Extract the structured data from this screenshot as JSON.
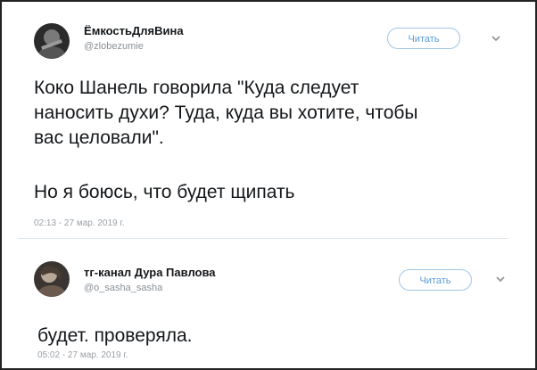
{
  "tweets": [
    {
      "name": "ЁмкостьДляВина",
      "handle": "@zlobezumie",
      "follow_label": "Читать",
      "body_paragraph_1": [
        "Коко Шанель говорила \"Куда следует",
        "наносить духи? Туда, куда вы хотите, чтобы",
        "вас целовали\"."
      ],
      "body_paragraph_2": "Но я боюсь, что будет щипать",
      "timestamp": "02:13 - 27 мар. 2019 г.",
      "avatar_icon": "avatar-photo-icon"
    },
    {
      "name": "тг-канал Дура Павлова",
      "handle": "@o_sasha_sasha",
      "follow_label": "Читать",
      "body": "будет. проверяла.",
      "timestamp": "05:02 - 27 мар. 2019 г.",
      "avatar_icon": "avatar-photo-icon"
    }
  ],
  "colors": {
    "accent": "#5a9bd5",
    "text": "#14171a",
    "muted": "#8a9096",
    "divider": "#e1e8ed"
  }
}
